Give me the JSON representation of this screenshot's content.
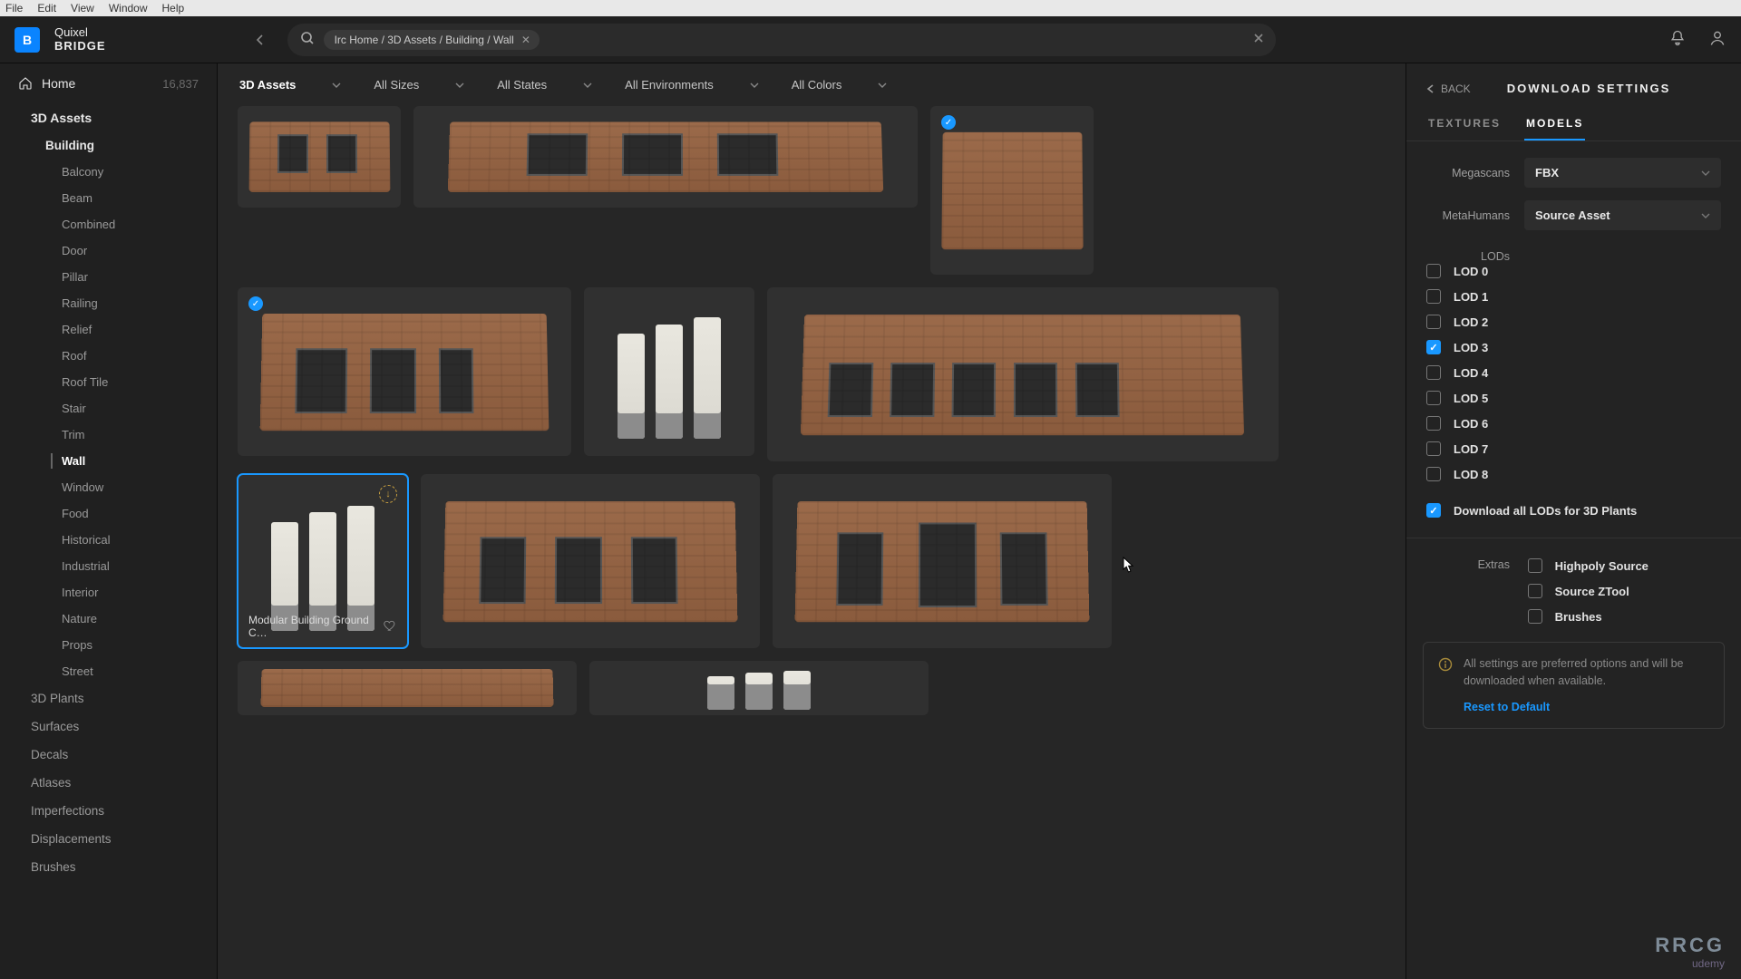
{
  "menu": {
    "file": "File",
    "edit": "Edit",
    "view": "View",
    "window": "Window",
    "help": "Help"
  },
  "brand": {
    "glyph": "B",
    "line1": "Quixel",
    "line2": "BRIDGE"
  },
  "search": {
    "chip": "Irc Home / 3D Assets / Building / Wall"
  },
  "sidebar": {
    "home": "Home",
    "home_count": "16,837",
    "l1": "3D Assets",
    "l2": "Building",
    "children": [
      "Balcony",
      "Beam",
      "Combined",
      "Door",
      "Pillar",
      "Railing",
      "Relief",
      "Roof",
      "Roof Tile",
      "Stair",
      "Trim",
      "Wall",
      "Window"
    ],
    "active": "Wall",
    "others": [
      "Food",
      "Historical",
      "Industrial",
      "Interior",
      "Nature",
      "Props",
      "Street"
    ],
    "root": [
      "3D Plants",
      "Surfaces",
      "Decals",
      "Atlases",
      "Imperfections",
      "Displacements",
      "Brushes"
    ]
  },
  "filters": [
    {
      "label": "3D Assets"
    },
    {
      "label": "All Sizes"
    },
    {
      "label": "All States"
    },
    {
      "label": "All Environments"
    },
    {
      "label": "All Colors"
    }
  ],
  "selected_card_caption": "Modular Building Ground C…",
  "panel": {
    "back": "BACK",
    "title": "DOWNLOAD SETTINGS",
    "tabs": {
      "textures": "TEXTURES",
      "models": "MODELS"
    },
    "megascans": {
      "label": "Megascans",
      "value": "FBX"
    },
    "metahumans": {
      "label": "MetaHumans",
      "value": "Source Asset"
    },
    "lods": {
      "label": "LODs",
      "items": [
        "LOD 0",
        "LOD 1",
        "LOD 2",
        "LOD 3",
        "LOD 4",
        "LOD 5",
        "LOD 6",
        "LOD 7",
        "LOD 8"
      ],
      "checked": "LOD 3",
      "all": "Download all LODs for 3D Plants"
    },
    "extras": {
      "label": "Extras",
      "items": [
        "Highpoly Source",
        "Source ZTool",
        "Brushes"
      ]
    },
    "info": "All settings are preferred options and will be downloaded when available.",
    "reset": "Reset to Default"
  },
  "watermark": {
    "a": "RRCG",
    "b": "udemy"
  }
}
